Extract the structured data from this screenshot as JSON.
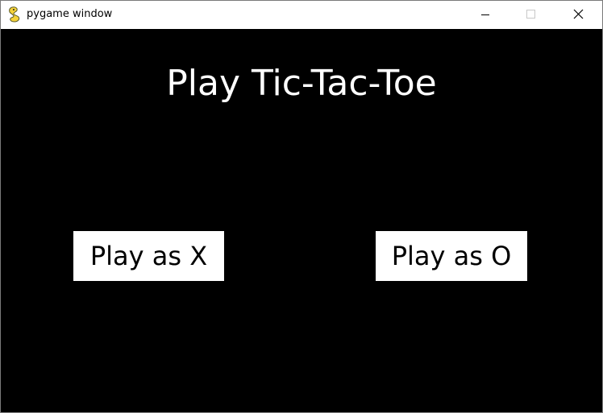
{
  "window": {
    "title": "pygame window",
    "icon": "pygame-snake-icon",
    "controls": {
      "minimize_icon": "minimize-icon",
      "maximize_icon": "maximize-icon",
      "close_icon": "close-icon"
    }
  },
  "game": {
    "title": "Play Tic-Tac-Toe",
    "buttons": {
      "play_x": "Play as X",
      "play_o": "Play as O"
    }
  },
  "colors": {
    "background": "#000000",
    "text": "#ffffff",
    "button_bg": "#ffffff",
    "button_text": "#000000"
  }
}
